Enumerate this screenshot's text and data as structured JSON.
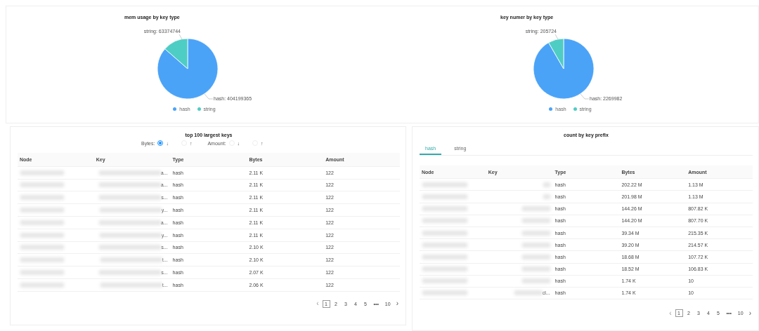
{
  "charts": [
    {
      "chart_data": {
        "type": "pie",
        "title": "mem usage by key type",
        "categories": [
          "hash",
          "string"
        ],
        "values": [
          404199365,
          63374744
        ],
        "value_labels": [
          "hash: 404199365",
          "string: 63374744"
        ]
      }
    },
    {
      "chart_data": {
        "type": "pie",
        "title": "key numer by key type",
        "categories": [
          "hash",
          "string"
        ],
        "values": [
          2269982,
          205724
        ],
        "value_labels": [
          "hash: 2269982",
          "string: 205724"
        ]
      }
    }
  ],
  "largest_keys": {
    "title": "top 100 largest keys",
    "sort_groups": [
      {
        "label": "Bytes:",
        "options": [
          {
            "arrow": "↓",
            "selected": true
          },
          {
            "arrow": "↑",
            "selected": false
          }
        ]
      },
      {
        "label": "Amount:",
        "options": [
          {
            "arrow": "↓",
            "selected": false
          },
          {
            "arrow": "↑",
            "selected": false
          }
        ]
      }
    ],
    "columns": [
      "Node",
      "Key",
      "Type",
      "Bytes",
      "Amount"
    ],
    "rows": [
      {
        "key": "a...",
        "type": "hash",
        "bytes": "2.11 K",
        "amount": "122"
      },
      {
        "key": "a...",
        "type": "hash",
        "bytes": "2.11 K",
        "amount": "122"
      },
      {
        "key": "s...",
        "type": "hash",
        "bytes": "2.11 K",
        "amount": "122"
      },
      {
        "key": "y...",
        "type": "hash",
        "bytes": "2.11 K",
        "amount": "122"
      },
      {
        "key": "a...",
        "type": "hash",
        "bytes": "2.11 K",
        "amount": "122"
      },
      {
        "key": "y...",
        "type": "hash",
        "bytes": "2.11 K",
        "amount": "122"
      },
      {
        "key": "s...",
        "type": "hash",
        "bytes": "2.10 K",
        "amount": "122"
      },
      {
        "key": "t...",
        "type": "hash",
        "bytes": "2.10 K",
        "amount": "122"
      },
      {
        "key": "s...",
        "type": "hash",
        "bytes": "2.07 K",
        "amount": "122"
      },
      {
        "key": "t...",
        "type": "hash",
        "bytes": "2.06 K",
        "amount": "122"
      }
    ],
    "pagination": {
      "prev": "‹",
      "next": "›",
      "pages": [
        {
          "label": "1",
          "selected": true
        },
        {
          "label": "2",
          "selected": false
        },
        {
          "label": "3",
          "selected": false
        },
        {
          "label": "4",
          "selected": false
        },
        {
          "label": "5",
          "selected": false
        },
        {
          "label": "•••",
          "selected": false
        },
        {
          "label": "10",
          "selected": false
        }
      ]
    }
  },
  "prefix_counts": {
    "title": "count by key prefix",
    "tabs": [
      {
        "label": "hash",
        "selected": true
      },
      {
        "label": "string",
        "selected": false
      }
    ],
    "columns": [
      "Node",
      "Key",
      "Type",
      "Bytes",
      "Amount"
    ],
    "rows": [
      {
        "type": "hash",
        "bytes": "202.22 M",
        "amount": "1.13 M"
      },
      {
        "type": "hash",
        "bytes": "201.98 M",
        "amount": "1.13 M"
      },
      {
        "type": "hash",
        "bytes": "144.26 M",
        "amount": "807.82 K"
      },
      {
        "type": "hash",
        "bytes": "144.20 M",
        "amount": "807.70 K"
      },
      {
        "type": "hash",
        "bytes": "39.34 M",
        "amount": "215.35 K"
      },
      {
        "type": "hash",
        "bytes": "39.20 M",
        "amount": "214.57 K"
      },
      {
        "type": "hash",
        "bytes": "18.68 M",
        "amount": "107.72 K"
      },
      {
        "type": "hash",
        "bytes": "18.52 M",
        "amount": "106.83 K"
      },
      {
        "type": "hash",
        "bytes": "1.74 K",
        "amount": "10"
      },
      {
        "key": "cl...",
        "type": "hash",
        "bytes": "1.74 K",
        "amount": "10"
      }
    ],
    "pagination": {
      "prev": "‹",
      "next": "›",
      "pages": [
        {
          "label": "1",
          "selected": true
        },
        {
          "label": "2",
          "selected": false
        },
        {
          "label": "3",
          "selected": false
        },
        {
          "label": "4",
          "selected": false
        },
        {
          "label": "5",
          "selected": false
        },
        {
          "label": "•••",
          "selected": false
        },
        {
          "label": "10",
          "selected": false
        }
      ]
    }
  }
}
